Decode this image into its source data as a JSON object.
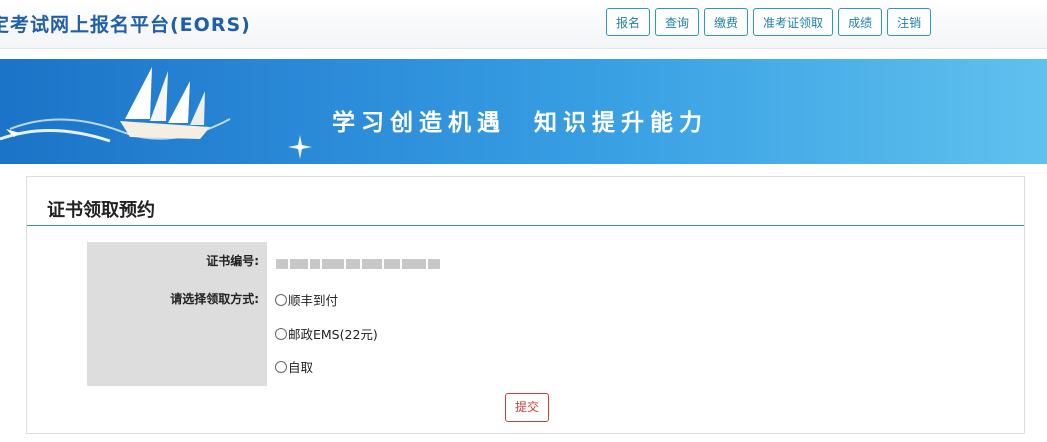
{
  "header": {
    "title": "定考试网上报名平台(EORS)",
    "nav": [
      "报名",
      "查询",
      "缴费",
      "准考证领取",
      "成绩",
      "注销"
    ]
  },
  "banner": {
    "slogan": "学习创造机遇  知识提升能力"
  },
  "form": {
    "title": "证书领取预约",
    "cert_label": "证书编号:",
    "method_label": "请选择领取方式:",
    "options": [
      "顺丰到付",
      "邮政EMS(22元)",
      "自取"
    ],
    "submit_label": "提交"
  },
  "colors": {
    "accent": "#2b93c8",
    "title_blue": "#1f5fa8",
    "submit_red": "#d33b3b",
    "label_bg": "#dddddd"
  }
}
